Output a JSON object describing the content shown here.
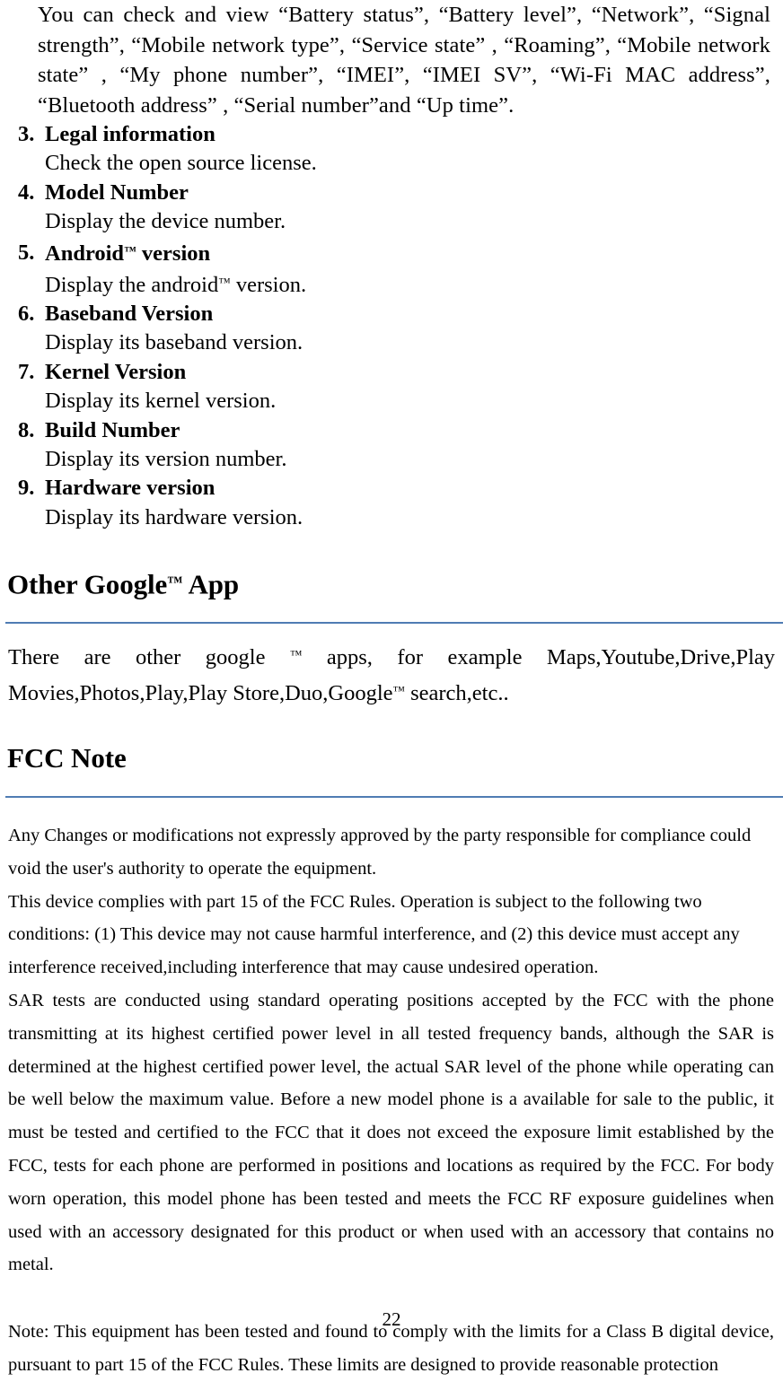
{
  "document": {
    "page_number": "22",
    "rule_color": "#4f7cb3"
  },
  "intro": {
    "paragraph": "You can check and view “Battery status”, “Battery level”, “Network”, “Signal strength”, “Mobile network type”, “Service state” , “Roaming”, “Mobile network state” , “My phone number”,    “IMEI”, “IMEI SV”, “Wi-Fi MAC address”, “Bluetooth address” , “Serial number”and “Up time”."
  },
  "settings_list": [
    {
      "number": "3.",
      "title": "Legal information",
      "title_suffix": "",
      "description": "Check the open source license.",
      "description_suffix": ""
    },
    {
      "number": "4.",
      "title": "Model Number",
      "title_suffix": "",
      "description": "Display the device number.",
      "description_suffix": ""
    },
    {
      "number": "5.",
      "title": "Android",
      "title_suffix": " version",
      "title_tm": "™",
      "description": "Display the android",
      "description_suffix": " version.",
      "description_tm": "™"
    },
    {
      "number": "6.",
      "title": "Baseband Version",
      "title_suffix": "",
      "description": "Display its baseband version.",
      "description_suffix": ""
    },
    {
      "number": "7.",
      "title": "Kernel Version",
      "title_suffix": "",
      "description": "Display its kernel version.",
      "description_suffix": ""
    },
    {
      "number": "8.",
      "title": "Build Number",
      "title_suffix": "",
      "description": "Display its version number.",
      "description_suffix": ""
    },
    {
      "number": "9.",
      "title": "Hardware version",
      "title_suffix": "",
      "description": "Display its hardware version.",
      "description_suffix": ""
    }
  ],
  "google_section": {
    "heading_prefix": "Other Google",
    "heading_tm": "™",
    "heading_suffix": "  App",
    "body_part1": "There are other google ",
    "body_tm1": "™",
    "body_part2": " apps, for example  Maps,Youtube,Drive,Play Movies,Photos,Play,Play Store,Duo,Google",
    "body_tm2": "™",
    "body_part3": "  search,etc.."
  },
  "fcc_section": {
    "heading": "FCC Note",
    "lines": [
      "Any Changes or modifications not expressly approved by the party responsible for compliance could",
      "void the user's authority to operate the equipment.",
      "This device complies with part 15 of the FCC Rules. Operation is subject to the following two",
      "conditions: (1) This device may not cause harmful interference, and (2) this device must accept any",
      "interference received,including interference that may cause undesired operation."
    ],
    "sar_paragraph": "SAR tests are conducted using standard operating positions accepted by the FCC with the phone transmitting at its highest certified power level in all tested frequency bands, although the SAR is determined at the highest certified power level, the actual SAR level of the phone while operating can be well below the maximum value. Before a new model phone is a available for sale to the public, it must be tested and certified to the FCC that it does not exceed the exposure limit established by the FCC, tests for each phone are performed in positions and locations as required by the FCC. For body worn operation, this model phone has been tested and meets the FCC RF exposure guidelines when used with an accessory designated for this product or when used with an accessory that contains no metal.",
    "note_paragraph": "Note: This equipment has been tested and found to comply with the limits for a Class B digital device, pursuant to part 15 of the FCC Rules. These limits are designed to provide reasonable protection"
  }
}
